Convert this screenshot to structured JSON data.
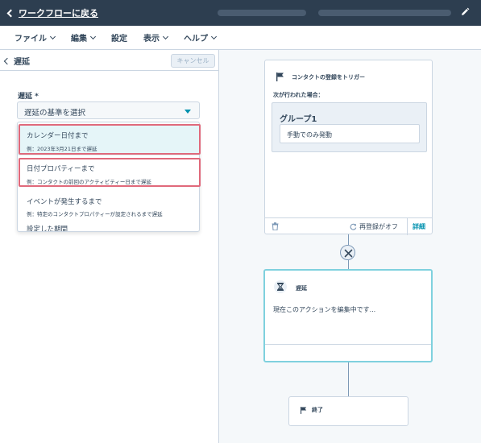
{
  "topbar": {
    "back_label": "ワークフローに戻る"
  },
  "menu": {
    "items": [
      {
        "label": "ファイル",
        "has_caret": true
      },
      {
        "label": "編集",
        "has_caret": true
      },
      {
        "label": "設定",
        "has_caret": false
      },
      {
        "label": "表示",
        "has_caret": true
      },
      {
        "label": "ヘルプ",
        "has_caret": true
      }
    ]
  },
  "panel": {
    "title": "遅延",
    "cancel_label": "キャンセル",
    "field_label": "遅延 *",
    "select_placeholder": "遅延の基準を選択",
    "options": [
      {
        "title": "カレンダー日付まで",
        "sub": "例：2023年3月21日まで遅延"
      },
      {
        "title": "日付プロパティーまで",
        "sub": "例：コンタクトの前回のアクティビティー日まで遅延"
      },
      {
        "title": "イベントが発生するまで",
        "sub": "例：特定のコンタクトプロパティーが設定されるまで遅延"
      },
      {
        "title": "設定した期間",
        "sub": ""
      }
    ]
  },
  "trigger": {
    "title": "コンタクトの登録をトリガー",
    "condition_label": "次が行われた場合：",
    "group_title": "グループ1",
    "filter_text": "手動でのみ発動",
    "reenroll_label": "再登録がオフ",
    "details_label": "詳細"
  },
  "delay_card": {
    "title": "遅延",
    "status_text": "現在このアクションを編集中です..."
  },
  "end_card": {
    "title": "終了"
  },
  "colors": {
    "topbar_bg": "#2d3e50",
    "accent": "#0091ae",
    "highlight_border": "#e0697b",
    "selected_card_border": "#7fd1de"
  }
}
